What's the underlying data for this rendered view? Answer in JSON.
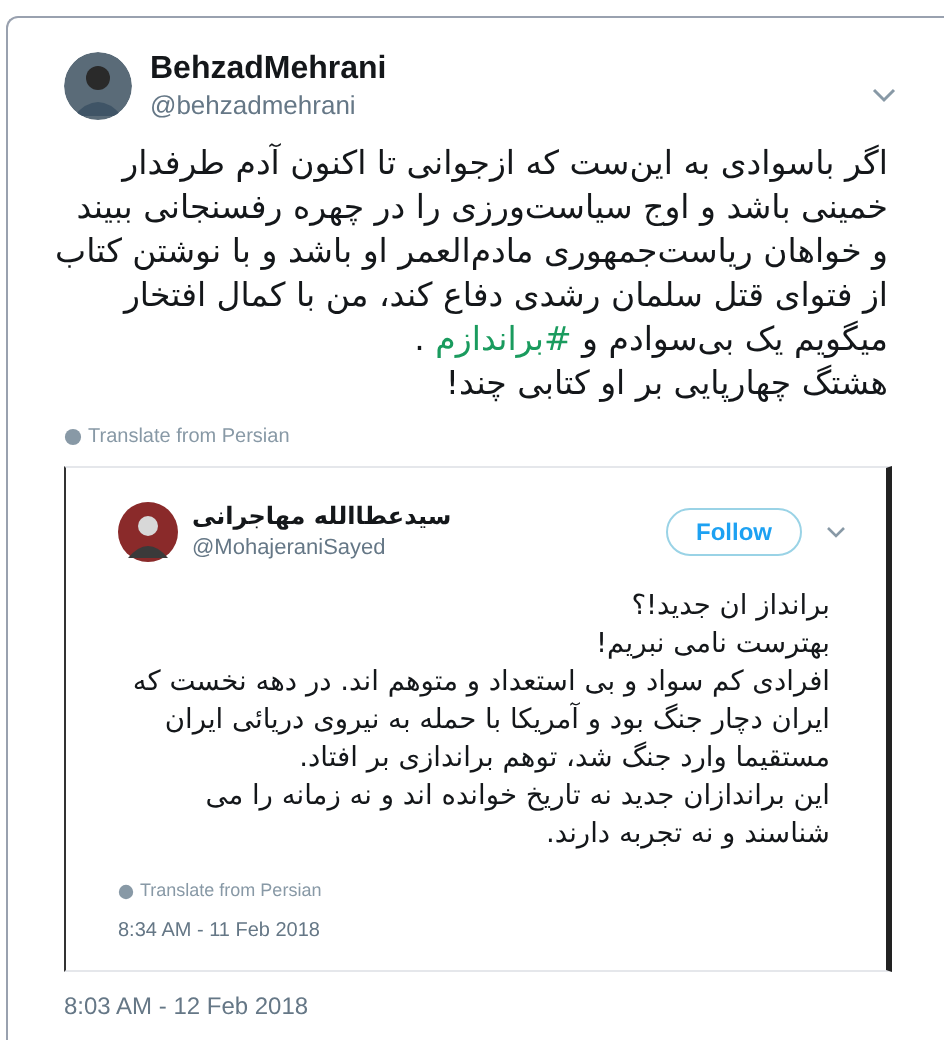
{
  "tweet": {
    "display_name": "BehzadMehrani",
    "handle": "@behzadmehrani",
    "lines": [
      {
        "text": "اگر باسوادی به این‌ست که ازجوانی تا اکنون آدم طرفدار"
      },
      {
        "text": "خمینی باشد و اوج سیاست‌ورزی را در چهره رفسنجانی ببیند"
      },
      {
        "text": "و خواهان ریاست‌جمهوری مادم‌العمر او باشد و با نوشتن کتاب"
      },
      {
        "text": "از فتوای قتل سلمان رشدی دفاع کند، من با کمال افتخار"
      },
      {
        "text": "میگویم یک بی‌سوادم و ",
        "hashtag": "#براندازم",
        "after": " ."
      },
      {
        "text": "هشتگ چهارپایی بر او کتابی چند!"
      }
    ],
    "translate": "Translate from Persian",
    "quoted": {
      "display_name": "سیدعطاالله مهاجرانی",
      "handle": "@MohajeraniSayed",
      "follow": "Follow",
      "lines": [
        "برانداز ان جدید!؟",
        "بهترست نامی نبریم!",
        "افرادی کم سواد و بی استعداد و متوهم اند. در دهه نخست که",
        "ایران دچار جنگ بود و آمریکا با حمله به نیروی دریائی ایران",
        "مستقیما وارد جنگ شد، توهم براندازی بر افتاد.",
        "این براندازان جدید نه تاریخ خوانده اند و نه زمانه را می",
        "شناسند و نه تجربه دارند."
      ],
      "translate": "Translate from Persian",
      "timestamp": "8:34 AM - 11 Feb 2018"
    },
    "timestamp": "8:03 AM - 12 Feb 2018"
  }
}
